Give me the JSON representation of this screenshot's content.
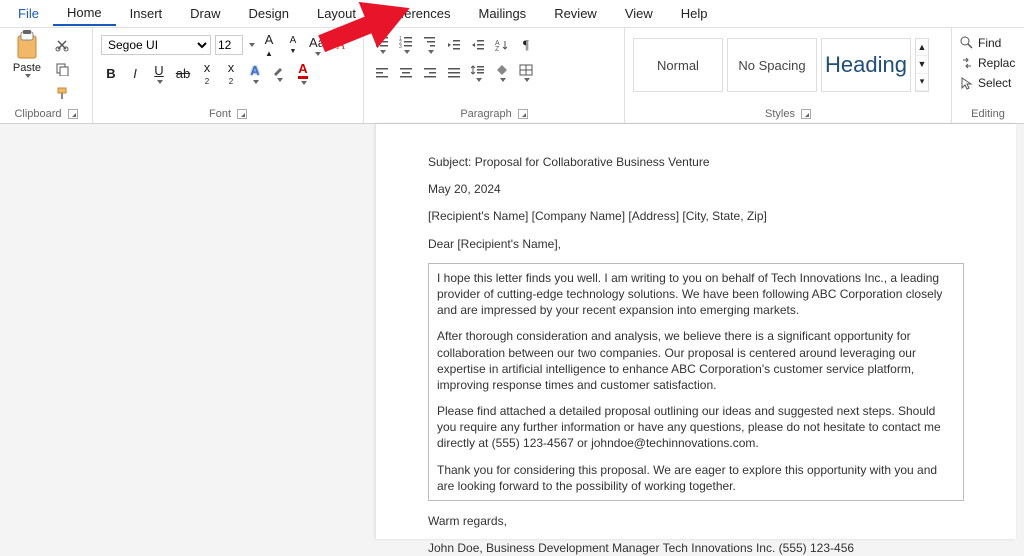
{
  "menubar": {
    "items": [
      "File",
      "Home",
      "Insert",
      "Draw",
      "Design",
      "Layout",
      "References",
      "Mailings",
      "Review",
      "View",
      "Help"
    ],
    "active_index": 1
  },
  "ribbon": {
    "clipboard": {
      "paste": "Paste",
      "group_label": "Clipboard"
    },
    "font": {
      "name": "Segoe UI",
      "size": "12",
      "group_label": "Font",
      "bold": "B",
      "italic": "I",
      "underline": "U",
      "strike": "ab",
      "sub": "x",
      "sup": "x",
      "case": "Aa",
      "clear": "A",
      "inc": "A",
      "dec": "A"
    },
    "paragraph": {
      "group_label": "Paragraph"
    },
    "styles": {
      "group_label": "Styles",
      "normal": "Normal",
      "nospacing": "No Spacing",
      "heading": "Heading"
    },
    "editing": {
      "group_label": "Editing",
      "find": "Find",
      "replace": "Replac",
      "select": "Select"
    }
  },
  "document": {
    "subject_line": "Subject: Proposal for Collaborative Business Venture",
    "date": "May 20, 2024",
    "recipient_line": "[Recipient's Name] [Company Name] [Address] [City, State, Zip]",
    "salutation": "Dear [Recipient's Name],",
    "body1": "I hope this letter finds you well. I am writing to you on behalf of Tech Innovations Inc., a leading provider of cutting-edge technology solutions. We have been following ABC Corporation closely and are impressed by your recent expansion into emerging markets.",
    "body2": "After thorough consideration and analysis, we believe there is a significant opportunity for collaboration between our two companies. Our proposal is centered around leveraging our expertise in artificial intelligence to enhance ABC Corporation's customer service platform, improving response times and customer satisfaction.",
    "body3": "Please find attached a detailed proposal outlining our ideas and suggested next steps. Should you require any further information or have any questions, please do not hesitate to contact me directly at (555) 123-4567 or johndoe@techinnovations.com.",
    "body4": "Thank you for considering this proposal. We are eager to explore this opportunity with you and are looking forward to the possibility of working together.",
    "closing": "Warm regards,",
    "signature": "John Doe, Business Development Manager Tech Innovations Inc. (555) 123-456"
  }
}
